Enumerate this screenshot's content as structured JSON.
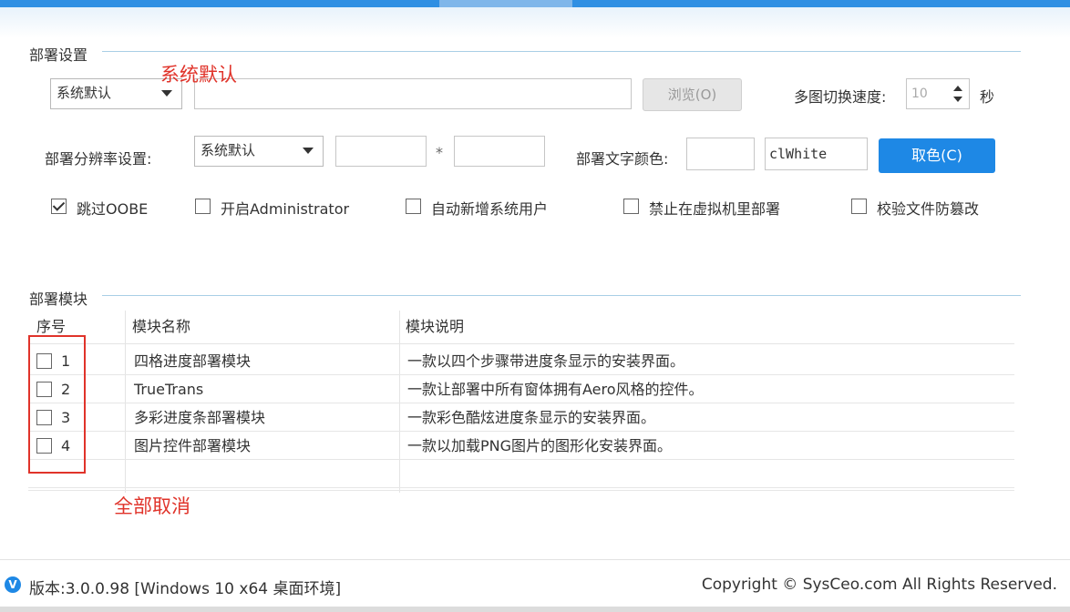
{
  "deploy_settings": {
    "group_title": "部署设置",
    "mode_select": "系统默认",
    "path_value": "",
    "browse_label": "浏览(O)",
    "switch_speed_label": "多图切换速度:",
    "switch_speed_value": "10",
    "seconds_label": "秒",
    "resolution_label": "部署分辨率设置:",
    "resolution_select": "系统默认",
    "width_value": "",
    "times": "*",
    "height_value": "",
    "text_color_label": "部署文字颜色:",
    "color_preview": "",
    "color_value": "clWhite",
    "pick_color_label": "取色(C)",
    "options": [
      {
        "label": "跳过OOBE",
        "checked": true
      },
      {
        "label": "开启Administrator",
        "checked": false
      },
      {
        "label": "自动新增系统用户",
        "checked": false
      },
      {
        "label": "禁止在虚拟机里部署",
        "checked": false
      },
      {
        "label": "校验文件防篡改",
        "checked": false
      }
    ]
  },
  "modules": {
    "group_title": "部署模块",
    "columns": [
      "序号",
      "模块名称",
      "模块说明"
    ],
    "rows": [
      {
        "no": "1",
        "name": "四格进度部署模块",
        "desc": "一款以四个步骤带进度条显示的安装界面。"
      },
      {
        "no": "2",
        "name": "TrueTrans",
        "desc": "一款让部署中所有窗体拥有Aero风格的控件。"
      },
      {
        "no": "3",
        "name": "多彩进度条部署模块",
        "desc": "一款彩色酷炫进度条显示的安装界面。"
      },
      {
        "no": "4",
        "name": "图片控件部署模块",
        "desc": "一款以加载PNG图片的图形化安装界面。"
      }
    ]
  },
  "annotations": {
    "top_note": "系统默认",
    "bottom_note": "全部取消",
    "color": "#e0332a"
  },
  "footer": {
    "badge": "V",
    "version": "版本:3.0.0.98 [Windows 10 x64 桌面环境]",
    "copyright": "Copyright © SysCeo.com All Rights Reserved."
  }
}
